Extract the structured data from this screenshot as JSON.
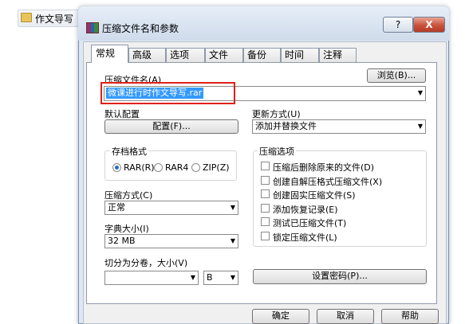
{
  "background_window": {
    "title": "作文导写"
  },
  "dialog": {
    "title": "压缩文件名和参数",
    "help_button": "?",
    "close_button": "X",
    "tabs": [
      "常规",
      "高级",
      "选项",
      "文件",
      "备份",
      "时间",
      "注释"
    ],
    "archive_name": {
      "label": "压缩文件名(A)",
      "value": "微课进行时作文导写.rar",
      "browse_button": "浏览(B)..."
    },
    "default_profile": {
      "label": "默认配置",
      "button": "配置(F)..."
    },
    "update_mode": {
      "label": "更新方式(U)",
      "value": "添加并替换文件"
    },
    "archive_format": {
      "label": "存档格式",
      "options": [
        "RAR(R)",
        "RAR4",
        "ZIP(Z)"
      ],
      "selected": "RAR(R)"
    },
    "compression_method": {
      "label": "压缩方式(C)",
      "value": "正常"
    },
    "dictionary_size": {
      "label": "字典大小(I)",
      "value": "32 MB"
    },
    "split_volumes": {
      "label": "切分为分卷，大小(V)",
      "value": "",
      "unit": "B"
    },
    "archive_options": {
      "label": "压缩选项",
      "items": [
        "压缩后删除原来的文件(D)",
        "创建自解压格式压缩文件(X)",
        "创建固实压缩文件(S)",
        "添加恢复记录(E)",
        "测试已压缩文件(T)",
        "锁定压缩文件(L)"
      ]
    },
    "set_password_button": "设置密码(P)...",
    "buttons": {
      "ok": "确定",
      "cancel": "取消",
      "help": "帮助"
    }
  },
  "colors": {
    "highlight_box": "#e0201a",
    "selection": "#3399ff",
    "close_button": "#c8513a"
  }
}
